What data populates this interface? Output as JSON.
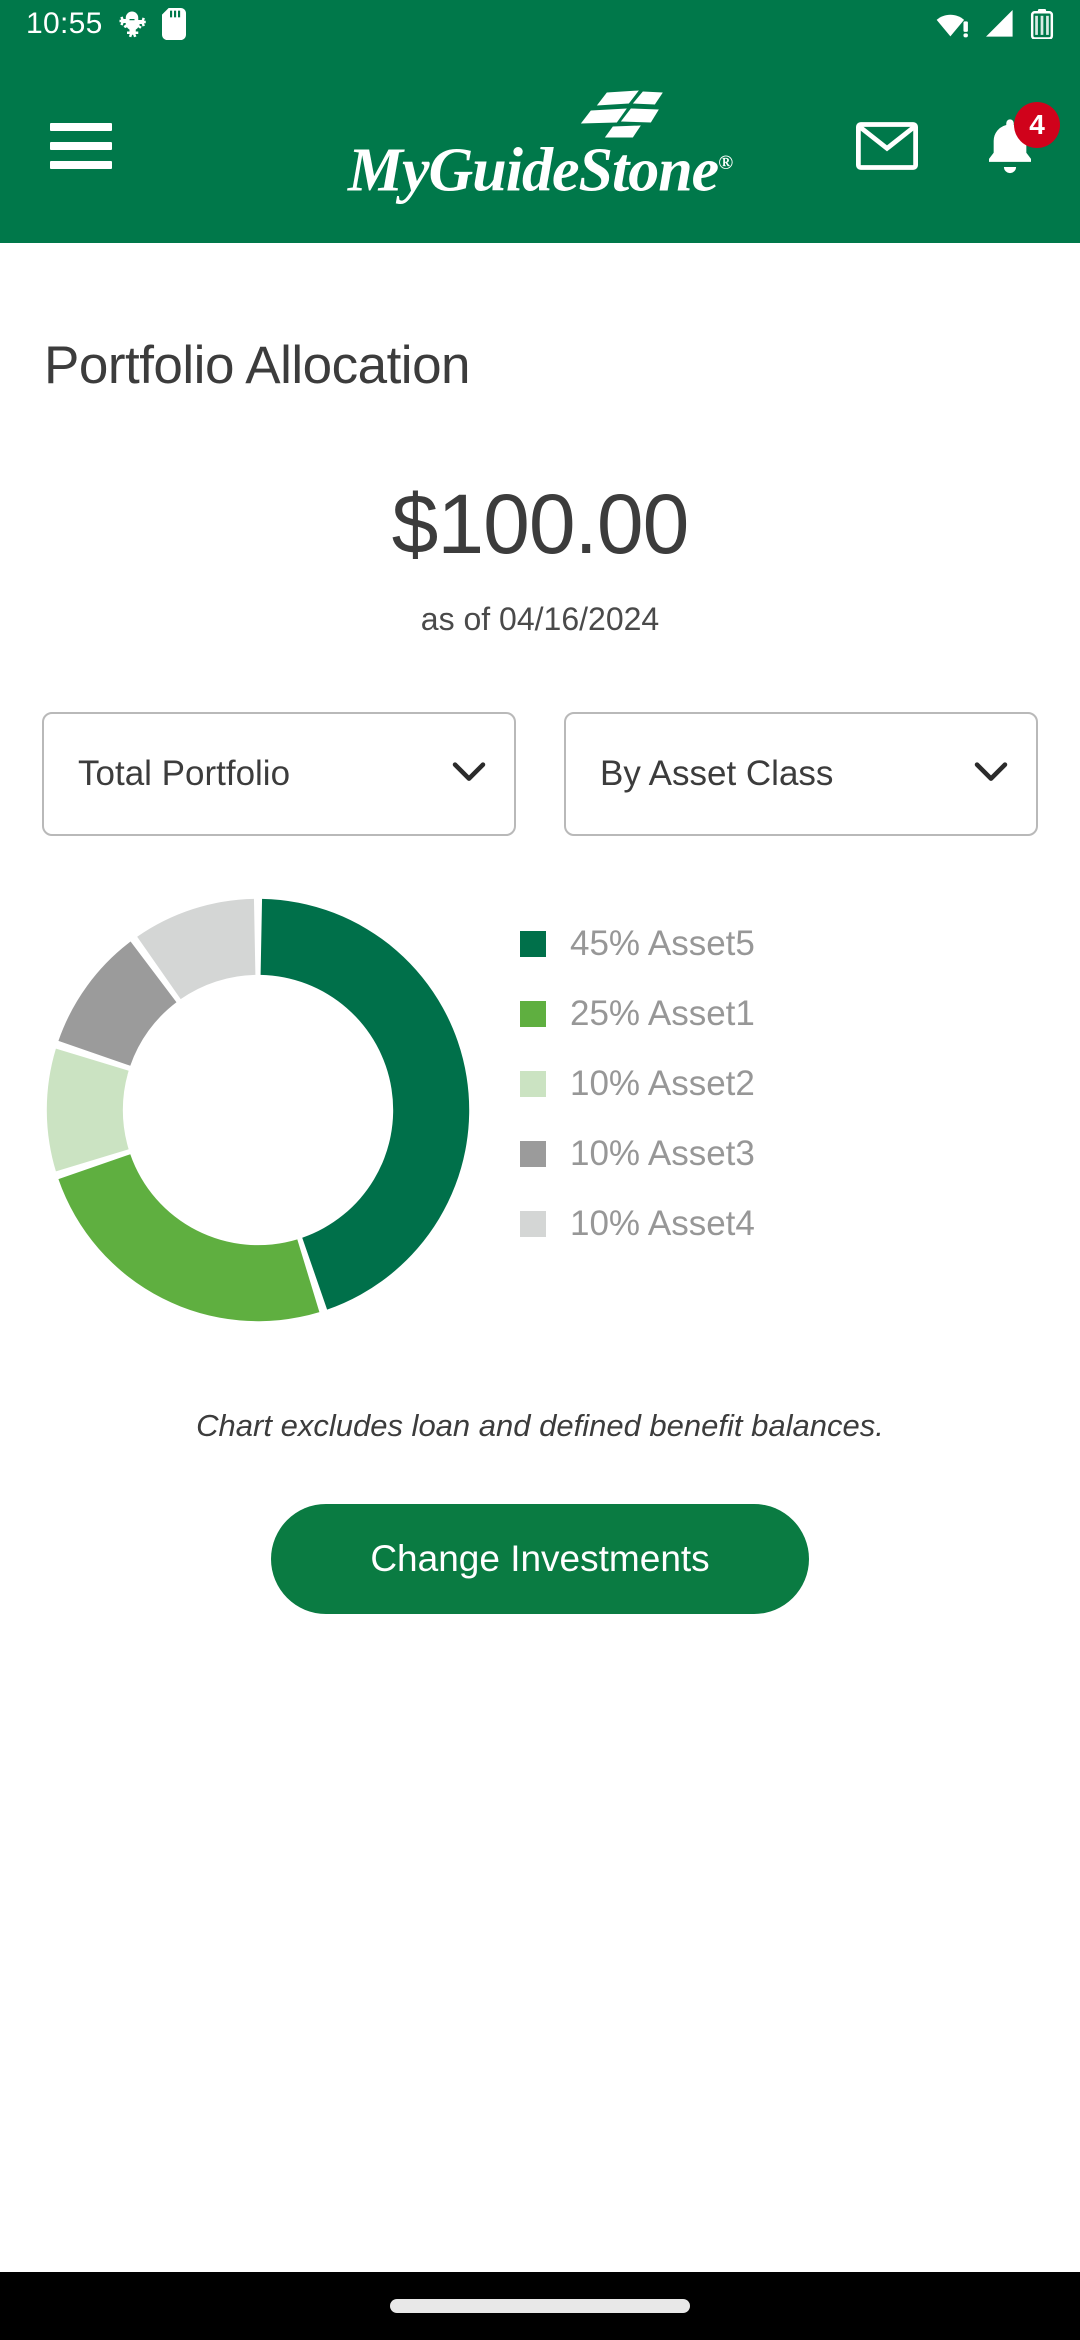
{
  "status_bar": {
    "time": "10:55",
    "left_icons": [
      "android-debug-icon",
      "sd-card-icon"
    ],
    "right_icons": [
      "wifi-warning-icon",
      "cellular-signal-icon",
      "battery-icon"
    ],
    "background_color": "#00784A"
  },
  "app_bar": {
    "menu_icon": "hamburger-menu-icon",
    "logo_text": "MyGuideStone",
    "logo_registered_mark": "®",
    "mail_icon": "mail-icon",
    "notifications_icon": "bell-icon",
    "notification_count": "4",
    "badge_color": "#D0021B",
    "background_color": "#00784A"
  },
  "main": {
    "page_title": "Portfolio Allocation",
    "balance": "$100.00",
    "as_of": "as of 04/16/2024",
    "selectors": [
      {
        "name": "portfolio-scope",
        "value": "Total Portfolio",
        "icon": "chevron-down-icon"
      },
      {
        "name": "grouping",
        "value": "By Asset Class",
        "icon": "chevron-down-icon"
      }
    ],
    "disclaimer": "Chart excludes loan and defined benefit balances.",
    "cta_label": "Change Investments",
    "cta_color": "#0A7B42"
  },
  "chart_data": {
    "type": "pie",
    "title": "Portfolio Allocation",
    "legend_position": "right",
    "donut": true,
    "inner_radius_ratio": 0.64,
    "start_angle": 0,
    "direction": "clockwise",
    "categories": [
      "Asset5",
      "Asset1",
      "Asset2",
      "Asset3",
      "Asset4"
    ],
    "values": [
      45,
      25,
      10,
      10,
      10
    ],
    "unit": "%",
    "colors": [
      "#00704A",
      "#5FAF40",
      "#CBE3C2",
      "#9B9B9B",
      "#D4D6D5"
    ],
    "legend_labels": [
      "45% Asset5",
      "25% Asset1",
      "10% Asset2",
      "10% Asset3",
      "10% Asset4"
    ],
    "legend_text_color": "#979797",
    "total_label": "$100.00",
    "total_as_of": "as of 04/16/2024"
  },
  "nav_bar": {
    "handle": "gesture-handle",
    "background_color": "#000000"
  }
}
